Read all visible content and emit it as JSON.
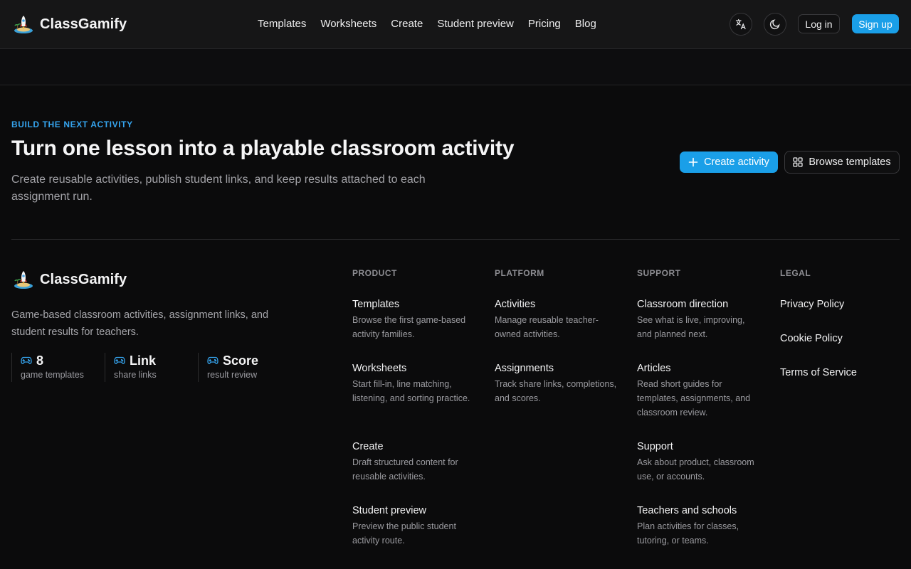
{
  "header": {
    "brand": "ClassGamify",
    "nav": [
      "Templates",
      "Worksheets",
      "Create",
      "Student preview",
      "Pricing",
      "Blog"
    ],
    "language_icon": "translate-icon",
    "theme_icon": "moon-icon",
    "login_label": "Log in",
    "signup_label": "Sign up"
  },
  "hero": {
    "eyebrow": "BUILD THE NEXT ACTIVITY",
    "title": "Turn one lesson into a playable classroom activity",
    "description": "Create reusable activities, publish student links, and keep results attached to each assignment run.",
    "create_label": "Create activity",
    "browse_label": "Browse templates",
    "accent": "#1a9fe8"
  },
  "footer": {
    "brand": "ClassGamify",
    "description": "Game-based classroom activities, assignment links, and student results for teachers.",
    "stats": [
      {
        "value": "8",
        "label": "game templates",
        "icon": "gamepad-icon"
      },
      {
        "value": "Link",
        "label": "share links",
        "icon": "gamepad-icon"
      },
      {
        "value": "Score",
        "label": "result review",
        "icon": "gamepad-icon"
      }
    ],
    "columns": [
      {
        "heading": "PRODUCT",
        "items": [
          {
            "title": "Templates",
            "desc": "Browse the first game-based activity families."
          },
          {
            "title": "Worksheets",
            "desc": "Start fill-in, line matching, listening, and sorting practice."
          },
          {
            "title": "Create",
            "desc": "Draft structured content for reusable activities."
          },
          {
            "title": "Student preview",
            "desc": "Preview the public student activity route."
          }
        ]
      },
      {
        "heading": "PLATFORM",
        "items": [
          {
            "title": "Activities",
            "desc": "Manage reusable teacher-owned activities."
          },
          {
            "title": "Assignments",
            "desc": "Track share links, completions, and scores."
          }
        ]
      },
      {
        "heading": "SUPPORT",
        "items": [
          {
            "title": "Classroom direction",
            "desc": "See what is live, improving, and planned next."
          },
          {
            "title": "Articles",
            "desc": "Read short guides for templates, assignments, and classroom review."
          },
          {
            "title": "Support",
            "desc": "Ask about product, classroom use, or accounts."
          },
          {
            "title": "Teachers and schools",
            "desc": "Plan activities for classes, tutoring, or teams."
          }
        ]
      },
      {
        "heading": "LEGAL",
        "items": [
          {
            "title": "Privacy Policy",
            "desc": ""
          },
          {
            "title": "Cookie Policy",
            "desc": ""
          },
          {
            "title": "Terms of Service",
            "desc": ""
          }
        ]
      }
    ]
  }
}
